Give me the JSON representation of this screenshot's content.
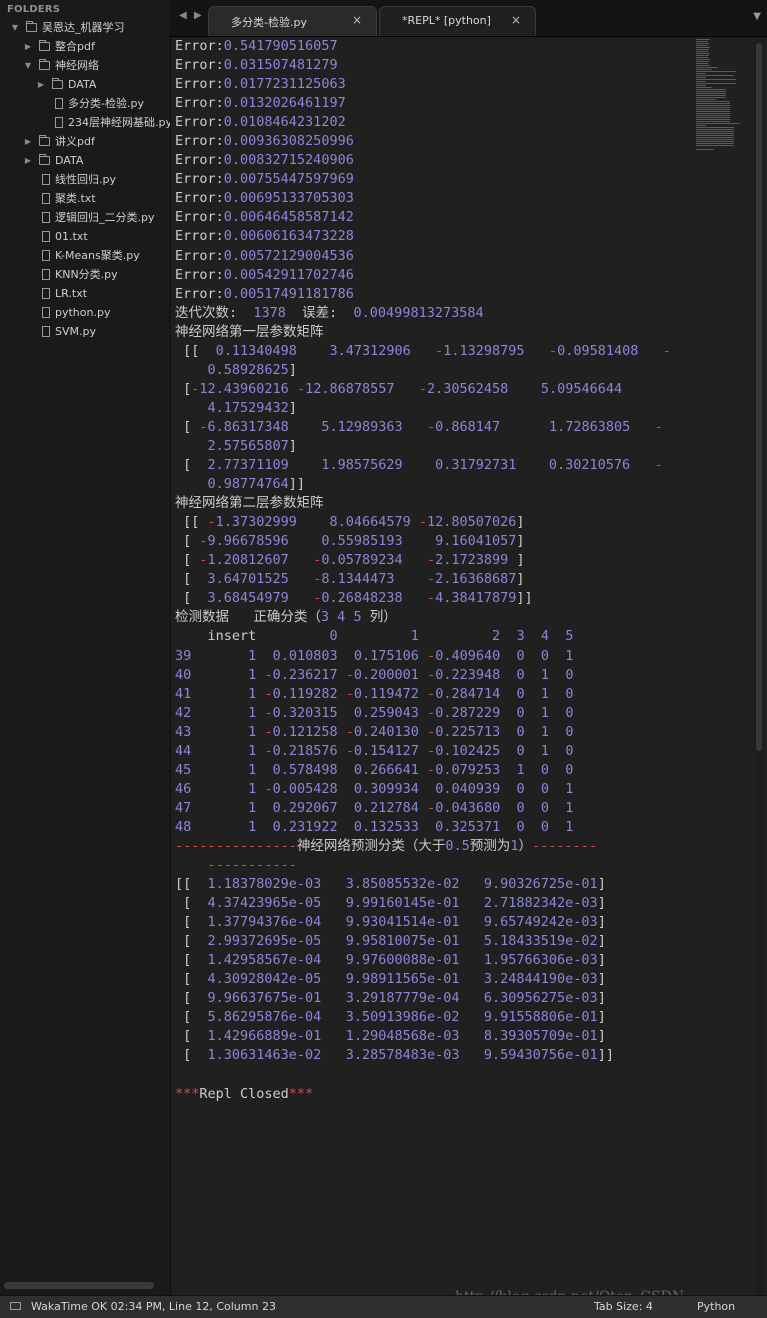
{
  "sidebar": {
    "title": "FOLDERS",
    "items": [
      {
        "label": "吴恩达_机器学习",
        "type": "folder",
        "expanded": true,
        "depth": 0
      },
      {
        "label": "整合pdf",
        "type": "folder",
        "expanded": false,
        "depth": 1
      },
      {
        "label": "神经网络",
        "type": "folder",
        "expanded": true,
        "depth": 1
      },
      {
        "label": "DATA",
        "type": "folder",
        "expanded": false,
        "depth": 2
      },
      {
        "label": "多分类-检验.py",
        "type": "file",
        "depth": 2
      },
      {
        "label": "234层神经网基础.py",
        "type": "file",
        "depth": 2
      },
      {
        "label": "讲义pdf",
        "type": "folder",
        "expanded": false,
        "depth": 1
      },
      {
        "label": "DATA",
        "type": "folder",
        "expanded": false,
        "depth": 1
      },
      {
        "label": "线性回归.py",
        "type": "file",
        "depth": 1
      },
      {
        "label": "聚类.txt",
        "type": "file",
        "depth": 1
      },
      {
        "label": "逻辑回归_二分类.py",
        "type": "file",
        "depth": 1
      },
      {
        "label": "01.txt",
        "type": "file",
        "depth": 1
      },
      {
        "label": "K-Means聚类.py",
        "type": "file",
        "depth": 1
      },
      {
        "label": "KNN分类.py",
        "type": "file",
        "depth": 1
      },
      {
        "label": "LR.txt",
        "type": "file",
        "depth": 1
      },
      {
        "label": "python.py",
        "type": "file",
        "depth": 1
      },
      {
        "label": "SVM.py",
        "type": "file",
        "depth": 1
      }
    ]
  },
  "tabs": [
    {
      "label": "多分类-检验.py",
      "active": false
    },
    {
      "label": "*REPL* [python]",
      "active": true
    }
  ],
  "tab_close_glyph": "×",
  "tab_nav": {
    "prev": "◀",
    "next": "▶",
    "dropdown": "▼"
  },
  "console": {
    "lines": [
      "Error:0.541790516057",
      "Error:0.031507481279",
      "Error:0.0177231125063",
      "Error:0.0132026461197",
      "Error:0.0108464231202",
      "Error:0.00936308250996",
      "Error:0.00832715240906",
      "Error:0.00755447597969",
      "Error:0.00695133705303",
      "Error:0.00646458587142",
      "Error:0.00606163473228",
      "Error:0.00572129004536",
      "Error:0.00542911702746",
      "Error:0.00517491181786",
      "迭代次数:  1378  误差:  0.00499813273584",
      "神经网络第一层参数矩阵",
      " [[  0.11340498    3.47312906   -1.13298795   -0.09581408   -",
      "    0.58928625]",
      " [-12.43960216 -12.86878557   -2.30562458    5.09546644",
      "    4.17529432]",
      " [ -6.86317348    5.12989363   -0.868147      1.72863805   -",
      "    2.57565807]",
      " [  2.77371109    1.98575629    0.31792731    0.30210576   -",
      "    0.98774764]]",
      "神经网络第二层参数矩阵",
      " [[ -1.37302999    8.04664579 -12.80507026]",
      " [ -9.96678596    0.55985193    9.16041057]",
      " [ -1.20812607   -0.05789234   -2.1723899 ]",
      " [  3.64701525   -8.1344473    -2.16368687]",
      " [  3.68454979   -0.26848238   -4.38417879]]",
      "检测数据   正确分类（3 4 5 列）",
      "    insert         0         1         2  3  4  5",
      "39       1  0.010803  0.175106 -0.409640  0  0  1",
      "40       1 -0.236217 -0.200001 -0.223948  0  1  0",
      "41       1 -0.119282 -0.119472 -0.284714  0  1  0",
      "42       1 -0.320315  0.259043 -0.287229  0  1  0",
      "43       1 -0.121258 -0.240130 -0.225713  0  1  0",
      "44       1 -0.218576 -0.154127 -0.102425  0  1  0",
      "45       1  0.578498  0.266641 -0.079253  1  0  0",
      "46       1 -0.005428  0.309934  0.040939  0  0  1",
      "47       1  0.292067  0.212784 -0.043680  0  0  1",
      "48       1  0.231922  0.132533  0.325371  0  0  1",
      "---------------神经网络预测分类（大于0.5预测为1）--------",
      "    -----------",
      "[[  1.18378029e-03   3.85085532e-02   9.90326725e-01]",
      " [  4.37423965e-05   9.99160145e-01   2.71882342e-03]",
      " [  1.37794376e-04   9.93041514e-01   9.65749242e-03]",
      " [  2.99372695e-05   9.95810075e-01   5.18433519e-02]",
      " [  1.42958567e-04   9.97600088e-01   1.95766306e-03]",
      " [  4.30928042e-05   9.98911565e-01   3.24844190e-03]",
      " [  9.96637675e-01   3.29187779e-04   6.30956275e-03]",
      " [  5.86295876e-04   3.50913986e-02   9.91558806e-01]",
      " [  1.42966889e-01   1.29048568e-03   8.39305709e-01]",
      " [  1.30631463e-02   3.28578483e-03   9.59430756e-01]]",
      "",
      "***Repl Closed***"
    ]
  },
  "status": {
    "left": "WakaTime OK 02:34 PM, Line 12, Column 23",
    "tab_size": "Tab Size: 4",
    "syntax": "Python"
  },
  "watermark": "http://blog.csdn.net/Qton_CSDN",
  "colors": {
    "background": "#202020",
    "text": "#cccccc",
    "number": "#8a86d8",
    "operator": "#d24a4a"
  }
}
